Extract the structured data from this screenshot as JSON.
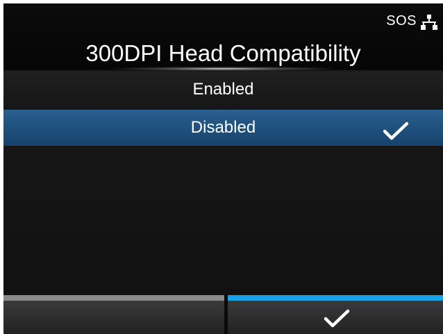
{
  "status": {
    "sos_label": "SOS",
    "network_icon": "network-icon"
  },
  "header": {
    "title": "300DPI Head Compatibility"
  },
  "options": [
    {
      "label": "Enabled",
      "selected": false
    },
    {
      "label": "Disabled",
      "selected": true,
      "icon": "check-icon"
    }
  ],
  "footer": {
    "left_button_icon": "none",
    "right_button_icon": "check-icon"
  },
  "colors": {
    "selected_bg": "#1d4f7d",
    "confirm_accent": "#19a3e6",
    "cancel_accent": "#8a8a8a"
  }
}
